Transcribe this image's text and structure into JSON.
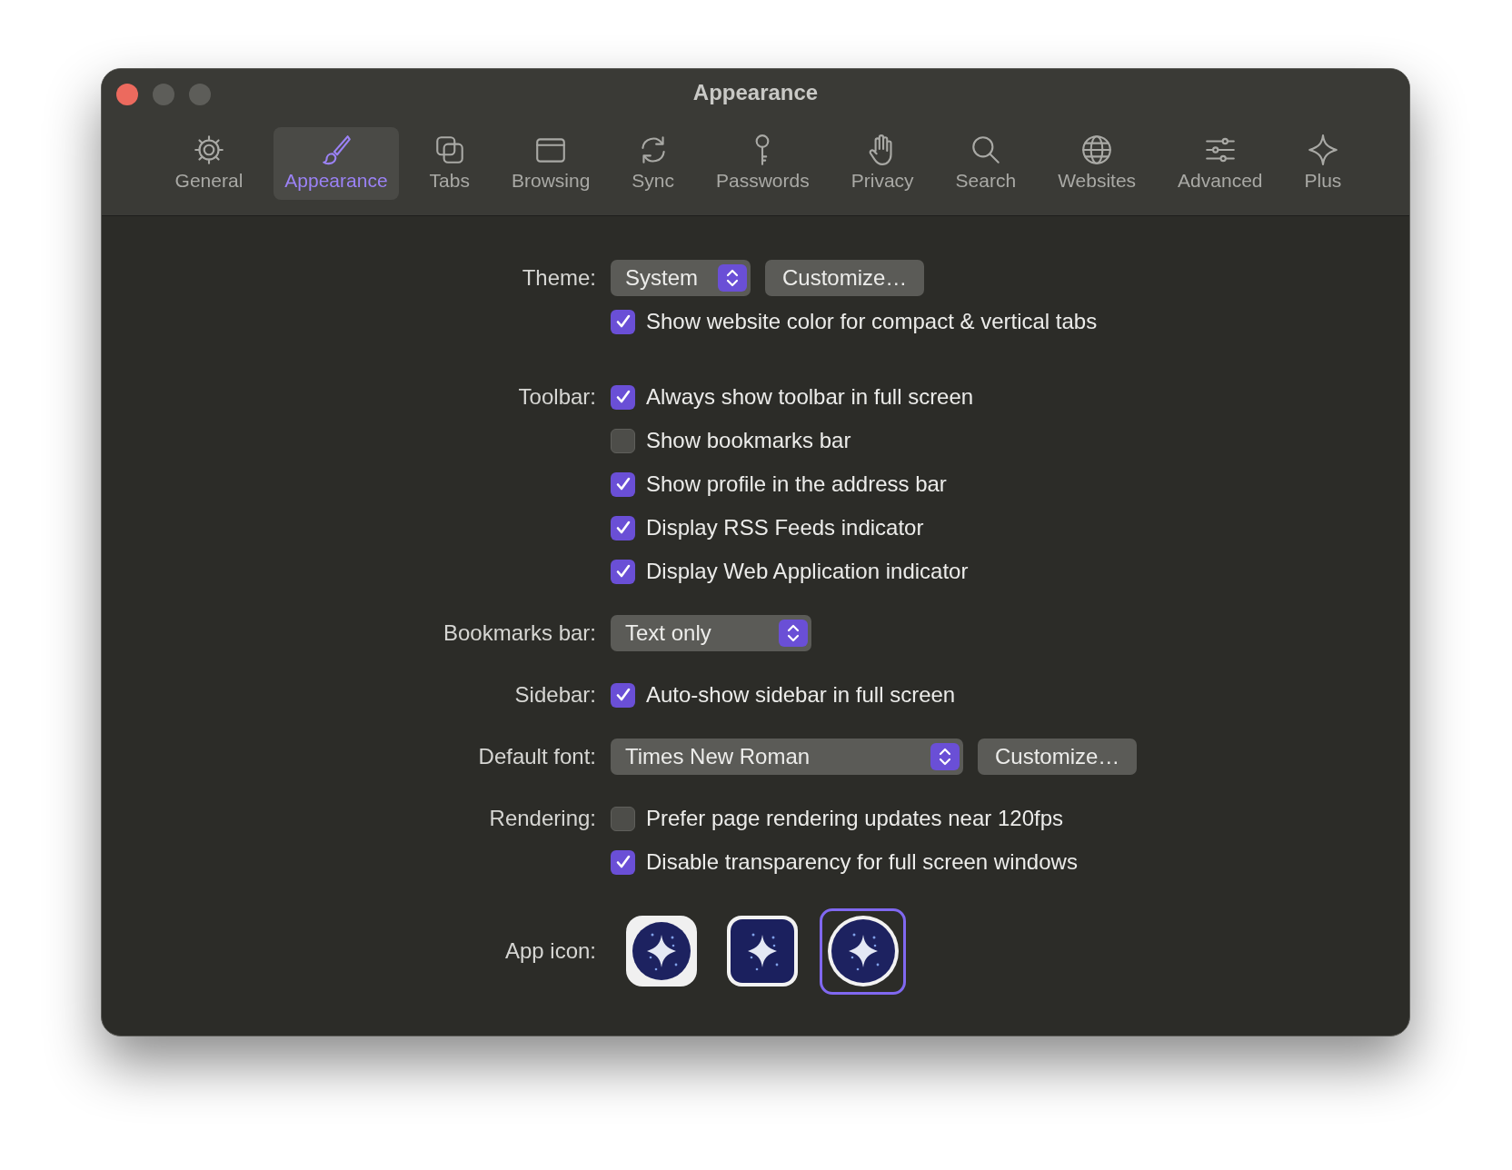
{
  "window": {
    "title": "Appearance"
  },
  "tabs": [
    {
      "label": "General",
      "selected": false
    },
    {
      "label": "Appearance",
      "selected": true
    },
    {
      "label": "Tabs",
      "selected": false
    },
    {
      "label": "Browsing",
      "selected": false
    },
    {
      "label": "Sync",
      "selected": false
    },
    {
      "label": "Passwords",
      "selected": false
    },
    {
      "label": "Privacy",
      "selected": false
    },
    {
      "label": "Search",
      "selected": false
    },
    {
      "label": "Websites",
      "selected": false
    },
    {
      "label": "Advanced",
      "selected": false
    },
    {
      "label": "Plus",
      "selected": false
    }
  ],
  "sections": [
    {
      "label": "Theme:",
      "rows": [
        [
          {
            "kind": "popup",
            "value": "System"
          },
          {
            "kind": "button",
            "label": "Customize…"
          }
        ],
        [
          {
            "kind": "checkbox",
            "label": "Show website color for compact & vertical tabs",
            "checked": true
          }
        ]
      ]
    },
    {
      "label": "Toolbar:",
      "rows": [
        [
          {
            "kind": "checkbox",
            "label": "Always show toolbar in full screen",
            "checked": true
          }
        ],
        [
          {
            "kind": "checkbox",
            "label": "Show bookmarks bar",
            "checked": false
          }
        ],
        [
          {
            "kind": "checkbox",
            "label": "Show profile in the address bar",
            "checked": true
          }
        ],
        [
          {
            "kind": "checkbox",
            "label": "Display RSS Feeds indicator",
            "checked": true
          }
        ],
        [
          {
            "kind": "checkbox",
            "label": "Display Web Application indicator",
            "checked": true
          }
        ]
      ]
    },
    {
      "label": "Bookmarks bar:",
      "rows": [
        [
          {
            "kind": "popup",
            "value": "Text only"
          }
        ]
      ]
    },
    {
      "label": "Sidebar:",
      "rows": [
        [
          {
            "kind": "checkbox",
            "label": "Auto-show sidebar in full screen",
            "checked": true
          }
        ]
      ]
    },
    {
      "label": "Default font:",
      "rows": [
        [
          {
            "kind": "popup",
            "value": "Times New Roman"
          },
          {
            "kind": "button",
            "label": "Customize…"
          }
        ]
      ]
    },
    {
      "label": "Rendering:",
      "rows": [
        [
          {
            "kind": "checkbox",
            "label": "Prefer page rendering updates near 120fps",
            "checked": false
          }
        ],
        [
          {
            "kind": "checkbox",
            "label": "Disable transparency for full screen windows",
            "checked": true
          }
        ]
      ]
    },
    {
      "label": "App icon:",
      "rows": [
        [
          {
            "kind": "app_icon",
            "selected": false
          },
          {
            "kind": "app_icon",
            "selected": false
          },
          {
            "kind": "app_icon",
            "selected": true
          }
        ]
      ]
    }
  ]
}
